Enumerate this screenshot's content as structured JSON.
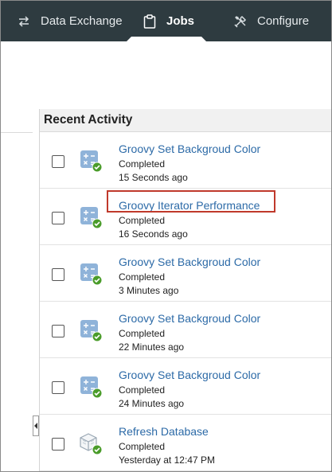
{
  "nav": {
    "items": [
      {
        "label": "Data Exchange",
        "icon": "swap-arrows-icon"
      },
      {
        "label": "Jobs",
        "icon": "clipboard-icon",
        "active": true
      },
      {
        "label": "Configure",
        "icon": "tools-icon"
      }
    ]
  },
  "panel": {
    "title": "Recent Activity",
    "rows": [
      {
        "title": "Groovy Set Backgroud Color",
        "status": "Completed",
        "time": "15 Seconds ago",
        "icon": "calculation-icon"
      },
      {
        "title": "Groovy Iterator Performance",
        "status": "Completed",
        "time": "16 Seconds ago",
        "icon": "calculation-icon",
        "highlighted": true
      },
      {
        "title": "Groovy Set Backgroud Color",
        "status": "Completed",
        "time": "3 Minutes ago",
        "icon": "calculation-icon"
      },
      {
        "title": "Groovy Set Backgroud Color",
        "status": "Completed",
        "time": "22 Minutes ago",
        "icon": "calculation-icon"
      },
      {
        "title": "Groovy Set Backgroud Color",
        "status": "Completed",
        "time": "24 Minutes ago",
        "icon": "calculation-icon"
      },
      {
        "title": "Refresh Database",
        "status": "Completed",
        "time": "Yesterday at 12:47 PM",
        "icon": "database-cube-icon"
      }
    ]
  },
  "colors": {
    "nav_bg": "#2e3b40",
    "link": "#2c6aa7",
    "success": "#4a9c2a",
    "highlight": "#c0392b"
  }
}
